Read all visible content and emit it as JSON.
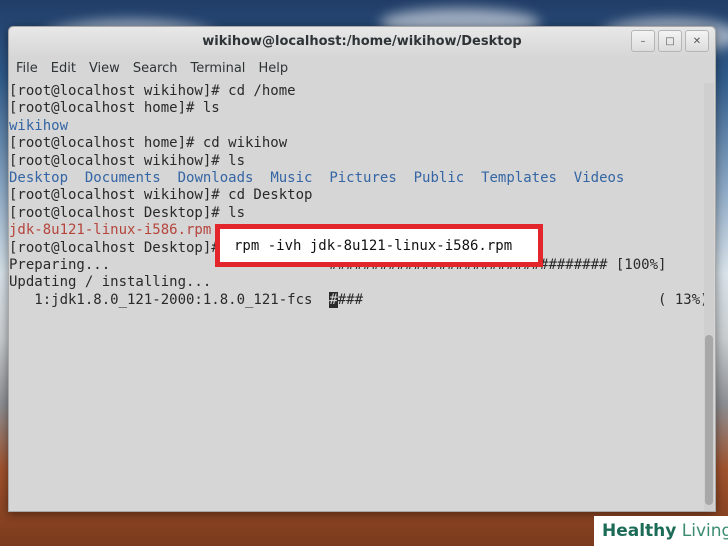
{
  "window": {
    "title": "wikihow@localhost:/home/wikihow/Desktop",
    "buttons": [
      "–",
      "□",
      "✕"
    ]
  },
  "menubar": [
    "File",
    "Edit",
    "View",
    "Search",
    "Terminal",
    "Help"
  ],
  "terminal": {
    "lines": [
      "[root@localhost wikihow]# cd /home",
      "[root@localhost home]# ls",
      "wikihow",
      "[root@localhost home]# cd wikihow",
      "[root@localhost wikihow]# ls",
      "[root@localhost wikihow]# cd Desktop",
      "[root@localhost Desktop]# ls",
      "jdk-8u121-linux-i586.rpm",
      "[root@localhost Desktop]# rpm -ivh jdk-8u121-linux-i586.rpm",
      "Preparing...                          ################################# [100%]",
      "Updating / installing...",
      "   1:jdk1.8.0_121-2000:1.8.0_121-fcs  ",
      "###                                   ( 13%)"
    ],
    "dirs": [
      "Desktop",
      "Documents",
      "Downloads",
      "Music",
      "Pictures",
      "Public",
      "Templates",
      "Videos"
    ],
    "cursor_char": "#"
  },
  "callout": {
    "text": "rpm -ivh jdk-8u121-linux-i586.rpm"
  },
  "watermark": {
    "brand_main": "Healthy",
    "brand_sub": " Living"
  },
  "colors": {
    "dir_blue": "#3465a4",
    "file_red": "#b5443b",
    "callout_border": "#e2262c"
  }
}
